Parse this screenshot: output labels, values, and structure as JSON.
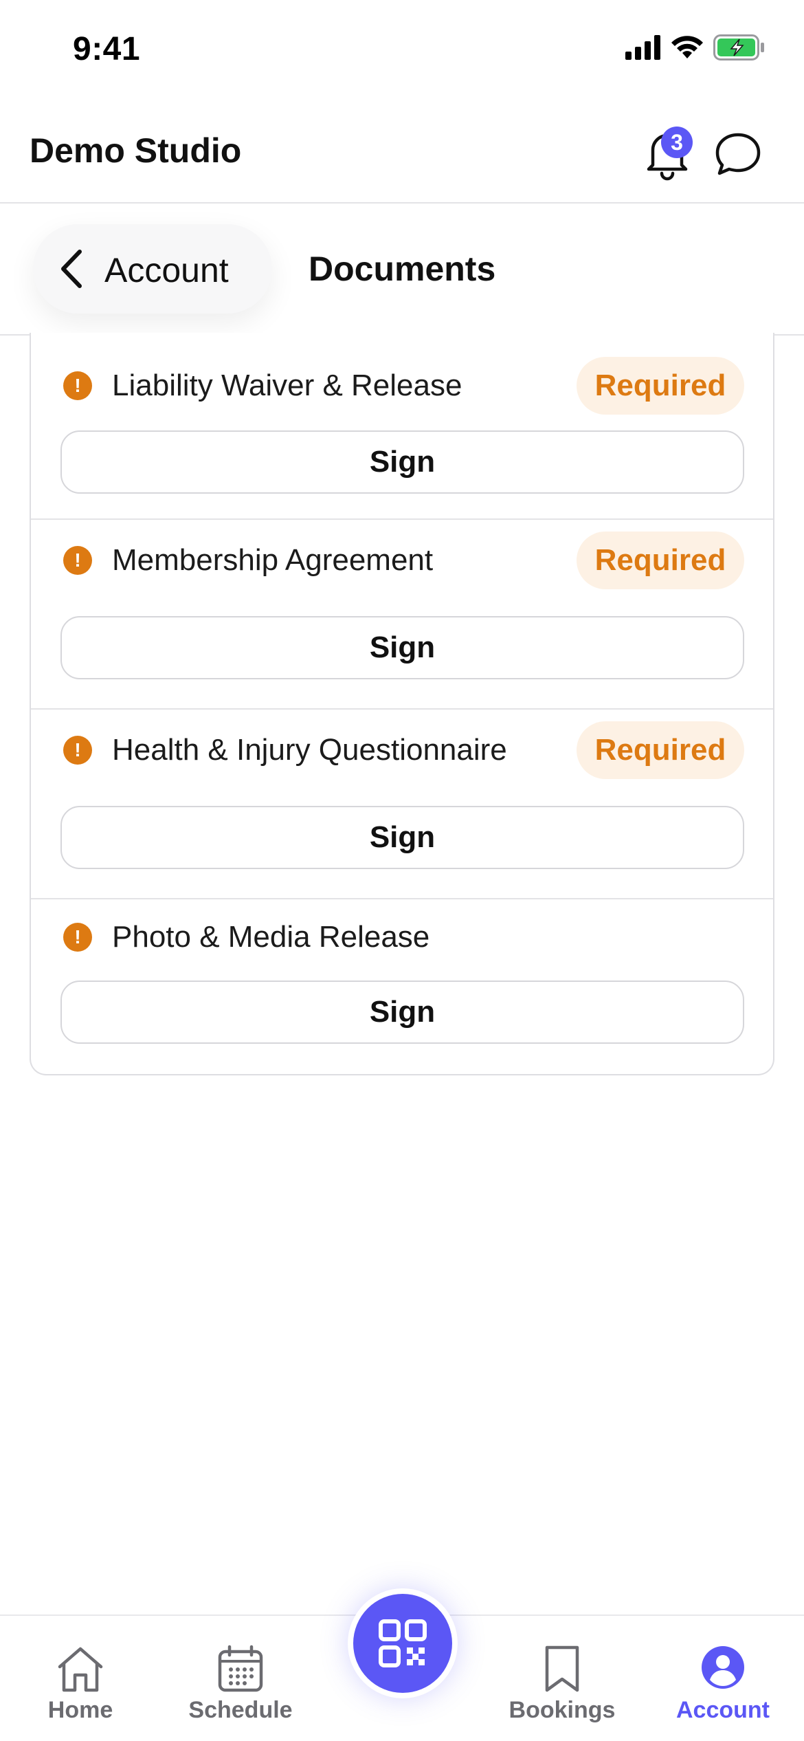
{
  "status_bar": {
    "time": "9:41"
  },
  "header": {
    "title": "Demo Studio",
    "notification_count": "3"
  },
  "sub_header": {
    "back_label": "Account",
    "title": "Documents"
  },
  "documents": [
    {
      "name": "Liability Waiver & Release",
      "badge": "Required",
      "action": "Sign"
    },
    {
      "name": "Membership Agreement",
      "badge": "Required",
      "action": "Sign"
    },
    {
      "name": "Health & Injury Questionnaire",
      "badge": "Required",
      "action": "Sign"
    },
    {
      "name": "Photo & Media Release",
      "badge": "",
      "action": "Sign"
    }
  ],
  "warning_glyph": "!",
  "tab_bar": {
    "items": [
      {
        "label": "Home",
        "icon": "house-icon",
        "active": false
      },
      {
        "label": "Schedule",
        "icon": "calendar-icon",
        "active": false
      },
      {
        "label": "Bookings",
        "icon": "bookmark-icon",
        "active": false
      },
      {
        "label": "Account",
        "icon": "person-icon",
        "active": true
      }
    ],
    "center_action_icon": "qr-code-icon"
  },
  "colors": {
    "accent": "#5b57f5",
    "warning": "#dd7a12",
    "warning_bg": "#fdf1e4",
    "battery_green": "#34c759"
  }
}
